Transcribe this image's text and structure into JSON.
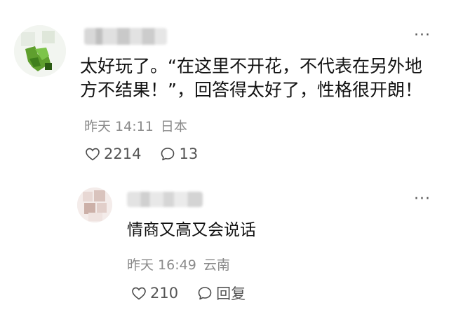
{
  "comments": [
    {
      "text": "太好玩了。“在这里不开花，不代表在另外地方不结果！”，回答得太好了，性格很开朗！",
      "time": "昨天 14:11",
      "location": "日本",
      "likes": "2214",
      "replies": "13",
      "more": "···"
    },
    {
      "text": "情商又高又会说话",
      "time": "昨天 16:49",
      "location": "云南",
      "likes": "210",
      "reply_label": "回复",
      "more": "···"
    }
  ],
  "icons": [
    "heart-icon",
    "comment-bubble-icon",
    "more-icon"
  ]
}
